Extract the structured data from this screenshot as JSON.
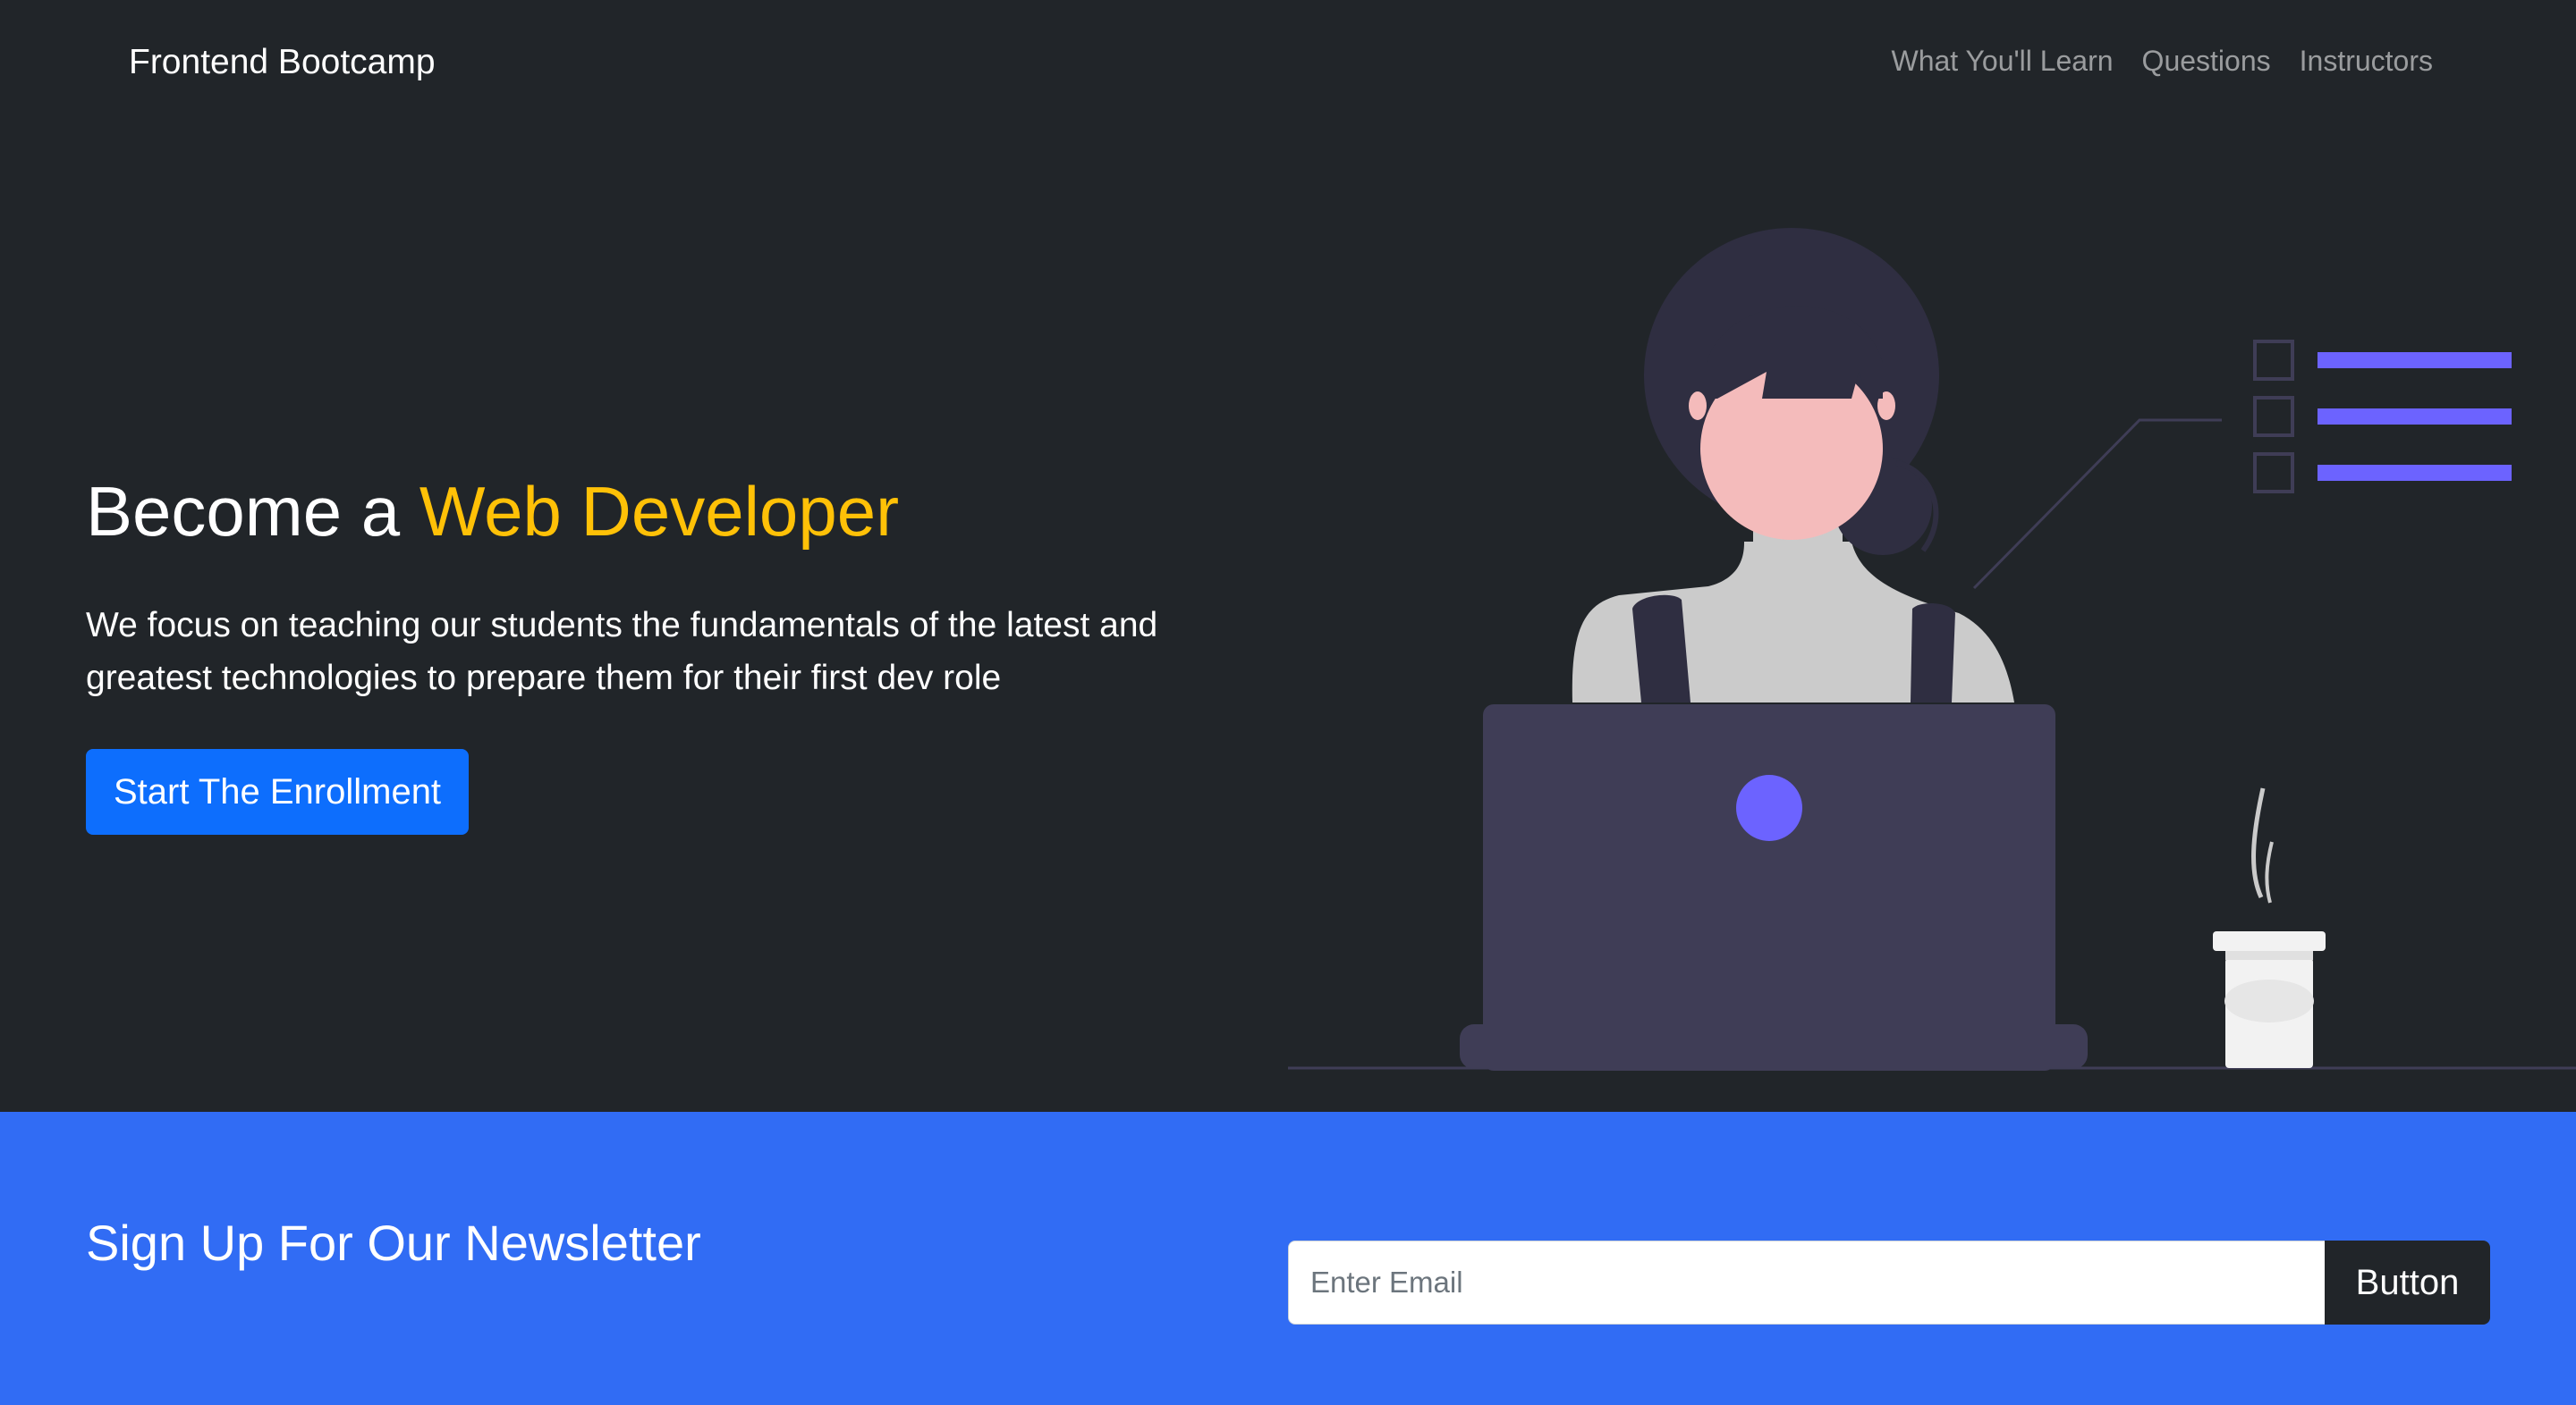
{
  "navbar": {
    "brand": "Frontend Bootcamp",
    "links": [
      "What You'll Learn",
      "Questions",
      "Instructors"
    ]
  },
  "hero": {
    "title_prefix": "Become a",
    "title_accent": "Web Developer",
    "description": "We focus on teaching our students the fundamentals of the latest and greatest technologies to prepare them for their first dev role",
    "cta_label": "Start The Enrollment",
    "illustration": "woman-at-laptop-illustration"
  },
  "newsletter": {
    "title": "Sign Up For Our Newsletter",
    "email_placeholder": "Enter Email",
    "email_value": "",
    "button_label": "Button"
  },
  "colors": {
    "background_dark": "#212529",
    "accent_yellow": "#ffc107",
    "primary_blue": "#0d6efd",
    "newsletter_blue": "#316cf4",
    "illustration_purple": "#6c63ff",
    "laptop": "#3f3d56"
  }
}
